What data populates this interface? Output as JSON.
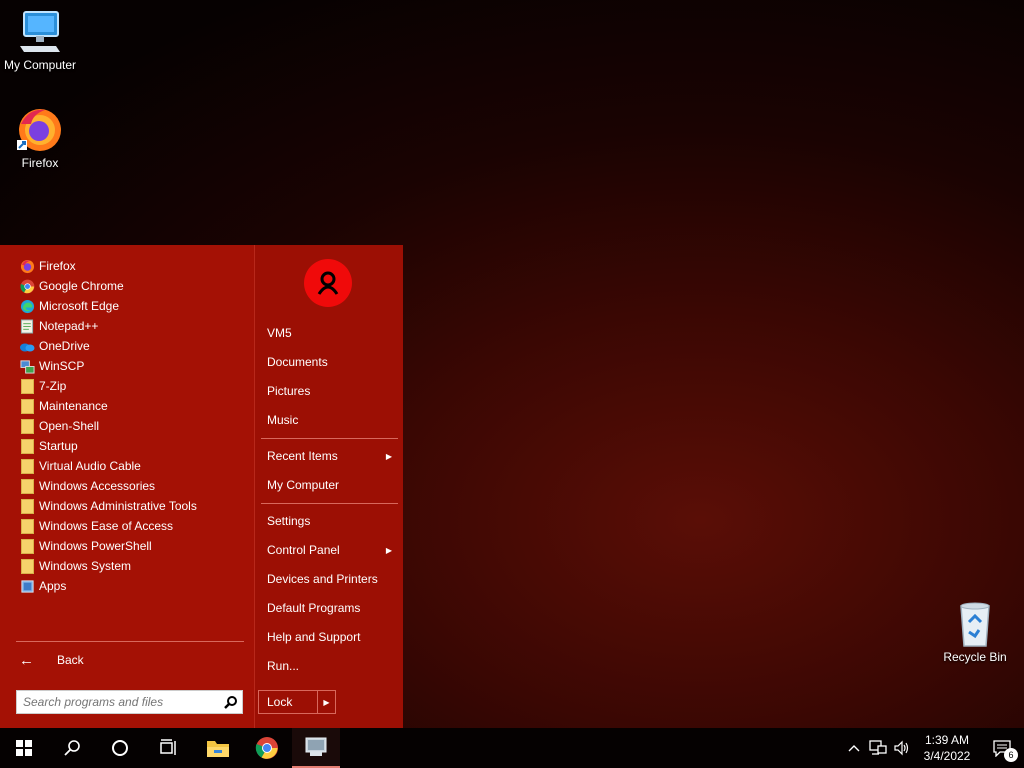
{
  "desktop": {
    "icons": [
      {
        "label": "My Computer",
        "icon": "computer-icon"
      },
      {
        "label": "Firefox",
        "icon": "firefox-icon"
      },
      {
        "label": "Recycle Bin",
        "icon": "recycle-bin-icon"
      }
    ]
  },
  "start_menu": {
    "programs": [
      {
        "label": "Firefox",
        "icon": "firefox-icon"
      },
      {
        "label": "Google Chrome",
        "icon": "chrome-icon"
      },
      {
        "label": "Microsoft Edge",
        "icon": "edge-icon"
      },
      {
        "label": "Notepad++",
        "icon": "notepadpp-icon"
      },
      {
        "label": "OneDrive",
        "icon": "onedrive-icon"
      },
      {
        "label": "WinSCP",
        "icon": "winscp-icon"
      },
      {
        "label": "7-Zip",
        "icon": "folder-icon"
      },
      {
        "label": "Maintenance",
        "icon": "folder-icon"
      },
      {
        "label": "Open-Shell",
        "icon": "folder-icon"
      },
      {
        "label": "Startup",
        "icon": "folder-icon"
      },
      {
        "label": "Virtual Audio Cable",
        "icon": "folder-icon"
      },
      {
        "label": "Windows Accessories",
        "icon": "folder-icon"
      },
      {
        "label": "Windows Administrative Tools",
        "icon": "folder-icon"
      },
      {
        "label": "Windows Ease of Access",
        "icon": "folder-icon"
      },
      {
        "label": "Windows PowerShell",
        "icon": "folder-icon"
      },
      {
        "label": "Windows System",
        "icon": "folder-icon"
      },
      {
        "label": "Apps",
        "icon": "apps-icon"
      }
    ],
    "back_label": "Back",
    "search_placeholder": "Search programs and files",
    "right": {
      "user": "VM5",
      "documents": "Documents",
      "pictures": "Pictures",
      "music": "Music",
      "recent_items": "Recent Items",
      "my_computer": "My Computer",
      "settings": "Settings",
      "control_panel": "Control Panel",
      "devices_printers": "Devices and Printers",
      "default_programs": "Default Programs",
      "help_support": "Help and Support",
      "run": "Run...",
      "lock": "Lock"
    }
  },
  "taskbar": {
    "time": "1:39 AM",
    "date": "3/4/2022",
    "notification_count": "6"
  },
  "colors": {
    "menu_bg": "#a41105",
    "accent_red": "#f00a0a",
    "taskbar_bg": "#050101"
  }
}
